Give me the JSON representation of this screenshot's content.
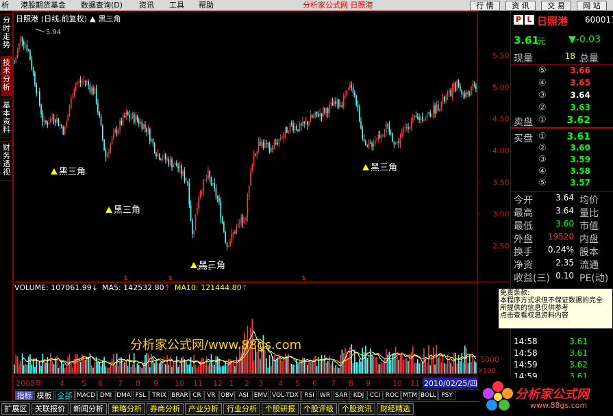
{
  "menu": {
    "items": [
      "析",
      "港股期货基金",
      "数据查询(D)",
      "资讯",
      "工具",
      "帮助"
    ],
    "title": "分析家公式网 日照港",
    "right_buttons": [
      "行 情",
      "资 讯",
      "交 易",
      "网 站"
    ]
  },
  "left_tabs": [
    "分时走势",
    "技术分析",
    "基本资料",
    "财务透视"
  ],
  "chart": {
    "stock_name": "日照港",
    "period": "(日线,前复权)",
    "indicator": "黑三角",
    "y_axis_labels": [
      "5.50",
      "5.00",
      "4.50",
      "4.00",
      "3.50",
      "3.00",
      "2.50"
    ],
    "high_label": "5.94",
    "low_label": "2.21",
    "annotation": "黑三角",
    "vol_axis_label": "5000",
    "vol_axis_unit": "X100",
    "volume": {
      "label": "VOLUME: 107061.99",
      "ma5": "MA5: 142532.80",
      "ma10": "MA10: 121444.80"
    },
    "x_axis_labels": [
      "2008年",
      "4",
      "5",
      "6",
      "7",
      "8",
      "9",
      "10",
      "11",
      "12",
      "1",
      "2",
      "3",
      "4",
      "5",
      "6",
      "7",
      "8",
      "9",
      "10",
      "11",
      "12",
      "2010/02/25/四"
    ],
    "down_arrow": "↓",
    "up_arrow": "↑",
    "dollar": "$"
  },
  "quote": {
    "code_prefix": "P L",
    "name": "日照港",
    "code": "600017",
    "price": "3.61",
    "price_unit": "元",
    "change": "▼-0.03",
    "xianliang_label": "现量",
    "xianliang_value": "18",
    "zongliang_label": "总量",
    "sell_label": "卖盘",
    "buy_label": "买盘",
    "sell": [
      {
        "idx": "⑤",
        "price": "3.66"
      },
      {
        "idx": "④",
        "price": "3.65"
      },
      {
        "idx": "③",
        "price": "3.64"
      },
      {
        "idx": "②",
        "price": "3.63"
      },
      {
        "idx": "①",
        "price": "3.62"
      }
    ],
    "buy": [
      {
        "idx": "①",
        "price": "3.61"
      },
      {
        "idx": "②",
        "price": "3.60"
      },
      {
        "idx": "③",
        "price": "3.59"
      },
      {
        "idx": "④",
        "price": "3.58"
      },
      {
        "idx": "⑤",
        "price": "3.57"
      }
    ],
    "stats": [
      {
        "l1": "今开",
        "v1": "3.64",
        "l2": "均价"
      },
      {
        "l1": "最高",
        "v1": "3.64",
        "l2": "量比"
      },
      {
        "l1": "最低",
        "v1": "3.60",
        "l2": "市值"
      },
      {
        "l1": "外盘",
        "v1": "19520",
        "l2": "内盘"
      },
      {
        "l1": "换手",
        "v1": "0.24%",
        "l2": "股本"
      },
      {
        "l1": "净资",
        "v1": "2.35",
        "l2": "流通"
      },
      {
        "l1": "收益(三)",
        "v1": "0.10",
        "l2": "PE(动)"
      }
    ],
    "ticks": [
      {
        "time": "14:58",
        "price": "3.61"
      },
      {
        "time": "14:58",
        "price": "3.61"
      },
      {
        "time": "14:59",
        "price": "3.62"
      },
      {
        "time": "14:59",
        "price": "3.61"
      },
      {
        "time": "14:59",
        "price": "3.61"
      }
    ]
  },
  "disclaimer": {
    "title": "免责条款:",
    "lines": [
      "本程序方式求但不保证数据的完全",
      "所提供的信息仅供参考",
      "点击查看权息资料内容"
    ]
  },
  "indicator_tabs": [
    "指标",
    "模板",
    "全部",
    "MACD",
    "DMI",
    "DMA",
    "FSL",
    "TRIX",
    "BRAR",
    "CR",
    "VR",
    "OBV",
    "ASI",
    "EMV",
    "VOL-TDX",
    "RSI",
    "WR",
    "SAR",
    "KDJ",
    "CCI",
    "ROC",
    "MTM",
    "BOLL",
    "PSY"
  ],
  "bottom_nav": [
    "扩展区",
    "关联报价",
    "新闻分析",
    "策略分析",
    "券商分析",
    "产业分析",
    "行业分析",
    "个股研报",
    "个股评级",
    "个股资讯",
    "财经精选"
  ],
  "watermark": "分析家公式网/www.88gs.com",
  "logo": {
    "text": "分析家公式网",
    "url": "www.88gs.com"
  }
}
